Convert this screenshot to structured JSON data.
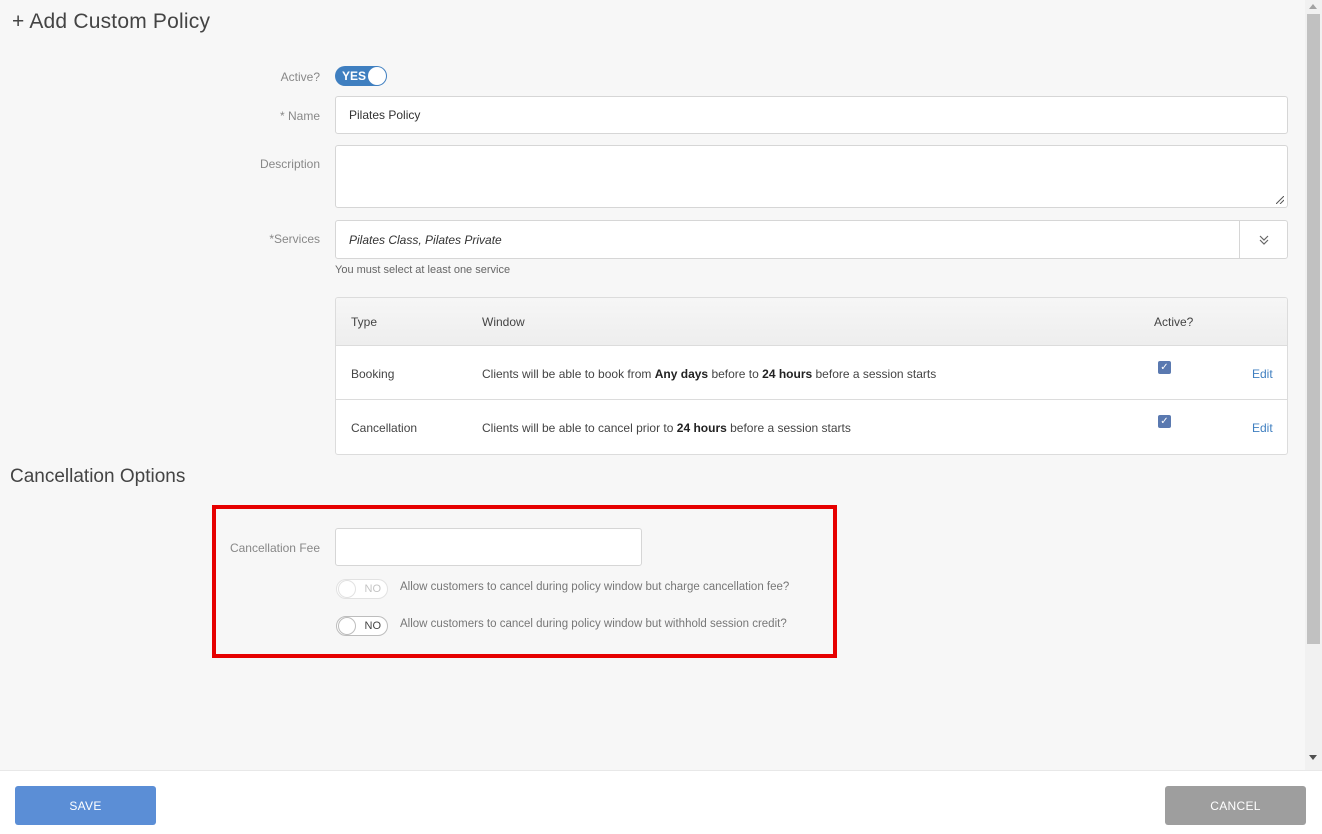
{
  "page_title": "+ Add Custom Policy",
  "form": {
    "active_label": "Active?",
    "active_value": "YES",
    "name_label": "* Name",
    "name_value": "Pilates Policy",
    "description_label": "Description",
    "description_value": "",
    "services_label": "*Services",
    "services_value": "Pilates Class, Pilates Private",
    "services_hint": "You must select at least one service"
  },
  "windows_table": {
    "headers": [
      "Type",
      "Window",
      "Active?"
    ],
    "rows": [
      {
        "type": "Booking",
        "window_pre": "Clients will be able to book from ",
        "window_b1": "Any days",
        "window_mid": " before to ",
        "window_b2": "24 hours",
        "window_post": " before a session starts",
        "active": true,
        "action": "Edit"
      },
      {
        "type": "Cancellation",
        "window_pre": "Clients will be able to cancel prior to ",
        "window_b1": "24 hours",
        "window_post": " before a session starts",
        "active": true,
        "action": "Edit"
      }
    ]
  },
  "cancellation_options": {
    "title": "Cancellation Options",
    "fee_label": "Cancellation Fee",
    "fee_value": "",
    "option1": {
      "toggle": "NO",
      "text": "Allow customers to cancel during policy window but charge cancellation fee?",
      "disabled": true
    },
    "option2": {
      "toggle": "NO",
      "text": "Allow customers to cancel during policy window but withhold session credit?",
      "disabled": false
    }
  },
  "footer": {
    "save_label": "SAVE",
    "cancel_label": "CANCEL"
  },
  "colors": {
    "accent": "#3f7fc0",
    "save_button": "#5b8ed6",
    "cancel_button": "#9e9e9e",
    "highlight": "#e60000"
  }
}
